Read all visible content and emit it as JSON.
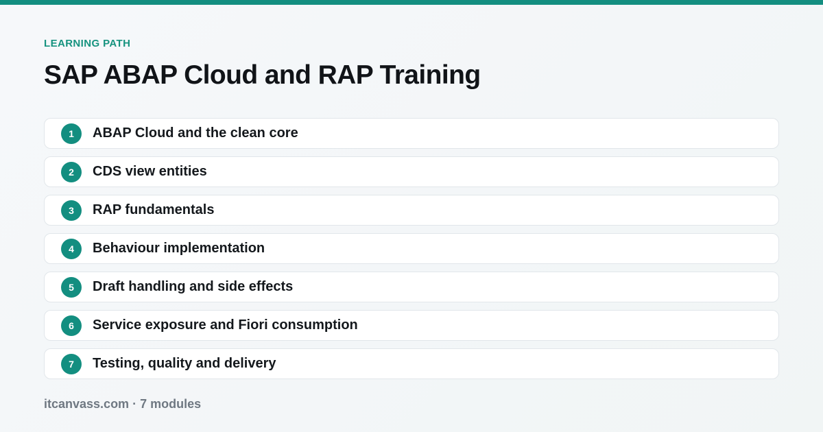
{
  "header": {
    "eyebrow": "LEARNING PATH",
    "title": "SAP ABAP Cloud and RAP Training"
  },
  "modules": [
    {
      "number": "1",
      "label": "ABAP Cloud and the clean core"
    },
    {
      "number": "2",
      "label": "CDS view entities"
    },
    {
      "number": "3",
      "label": "RAP fundamentals"
    },
    {
      "number": "4",
      "label": "Behaviour implementation"
    },
    {
      "number": "5",
      "label": "Draft handling and side effects"
    },
    {
      "number": "6",
      "label": "Service exposure and Fiori consumption"
    },
    {
      "number": "7",
      "label": "Testing, quality and delivery"
    }
  ],
  "footer": {
    "text": "itcanvass.com · 7 modules"
  },
  "colors": {
    "accent": "#138e80",
    "title": "#111418",
    "muted": "#6f7882",
    "card_border": "#e1e6ea"
  }
}
